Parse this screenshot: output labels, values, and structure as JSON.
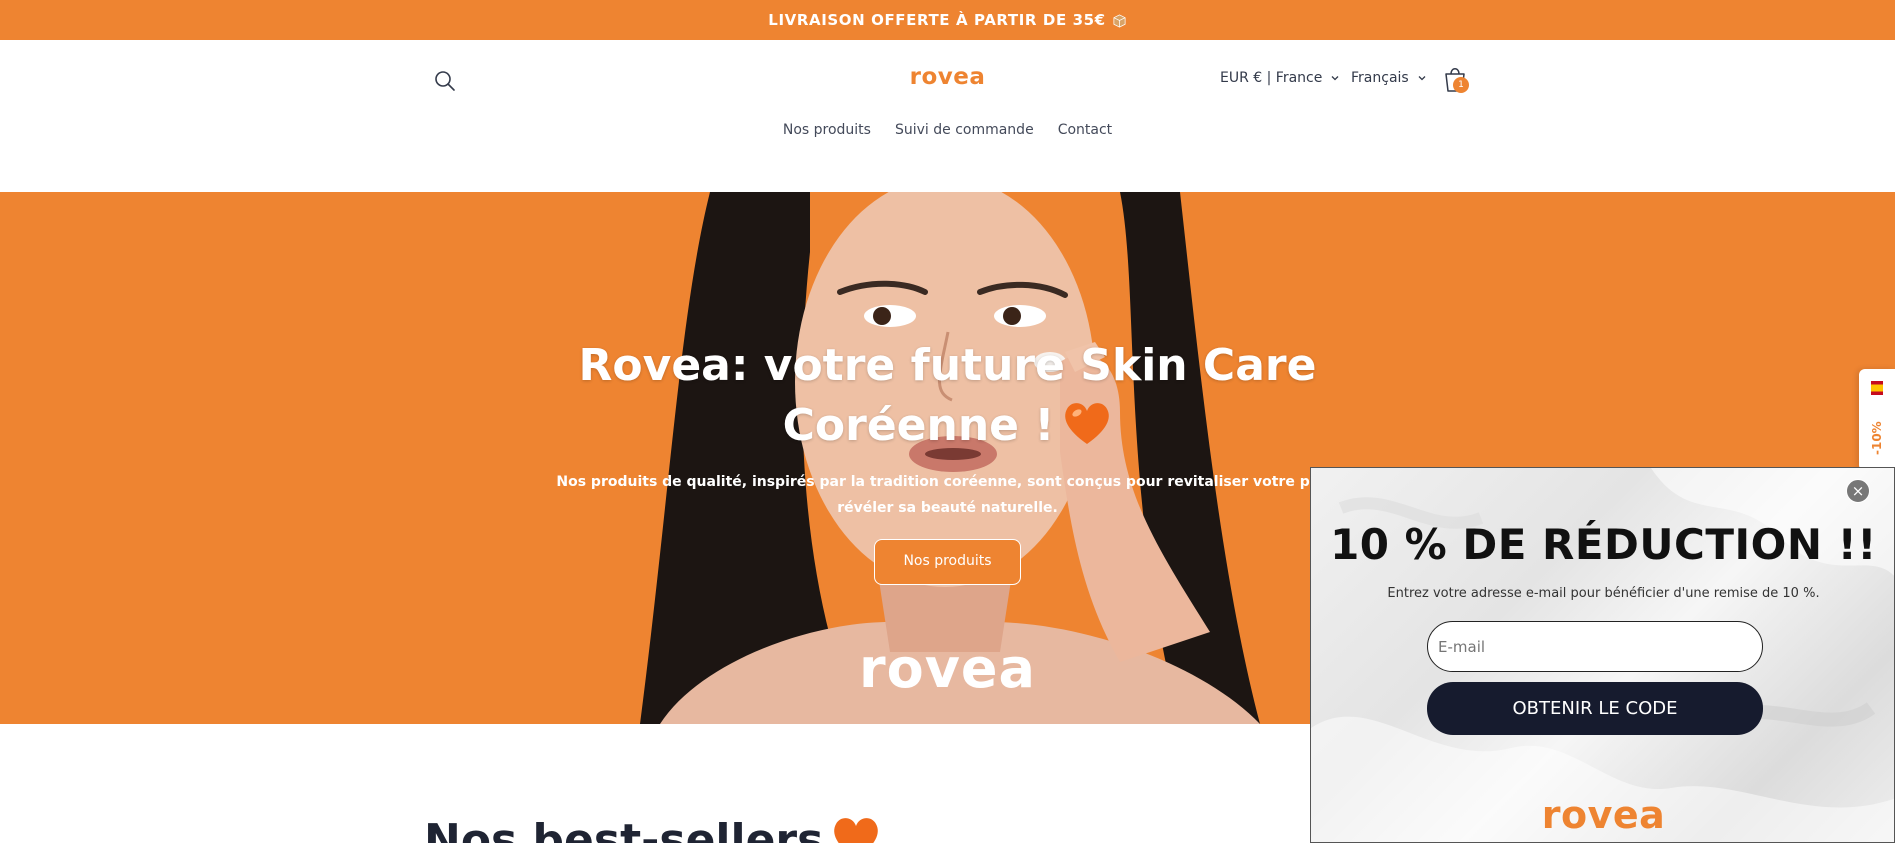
{
  "announcement": {
    "text": "LIVRAISON OFFERTE À PARTIR DE 35€",
    "icon": "package-icon"
  },
  "header": {
    "logo": "rovea",
    "currency": "EUR € | France",
    "language": "Français",
    "cart_count": "1",
    "nav": [
      {
        "label": "Nos produits"
      },
      {
        "label": "Suivi de commande"
      },
      {
        "label": "Contact"
      }
    ]
  },
  "hero": {
    "title": "Rovea: votre future Skin Care Coréenne !",
    "subtitle_line1": "Nos produits de qualité, inspirés par la tradition coréenne, sont conçus pour revitaliser votre peau",
    "subtitle_line2": "révéler sa beauté naturelle.",
    "cta": "Nos produits",
    "watermark_logo": "rovea"
  },
  "section": {
    "best_sellers_title": "Nos best-sellers"
  },
  "side_tab": {
    "label": "-10%"
  },
  "popup": {
    "title": "10 % DE RÉDUCTION !!",
    "subtitle": "Entrez votre adresse e-mail pour bénéficier d'une remise de 10 %.",
    "email_placeholder": "E-mail",
    "button": "OBTENIR LE CODE",
    "logo": "rovea",
    "close": "×"
  },
  "colors": {
    "brand_orange": "#ee8431",
    "navy": "#161b2e",
    "text_dark": "#1f2433"
  }
}
